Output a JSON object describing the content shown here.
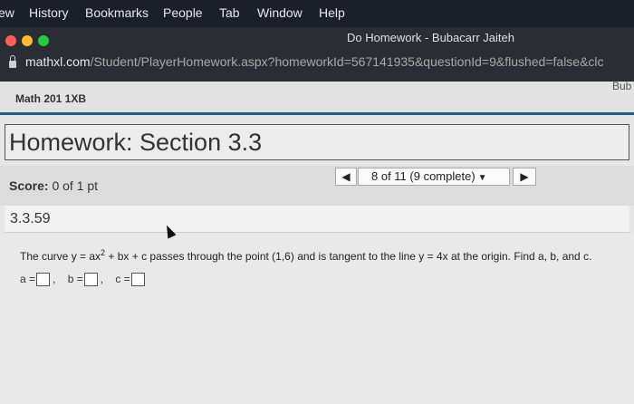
{
  "menubar": {
    "items": [
      "ew",
      "History",
      "Bookmarks",
      "People",
      "Tab",
      "Window",
      "Help"
    ]
  },
  "browser": {
    "window_title": "Do Homework - Bubacarr Jaiteh",
    "url_host": "mathxl.com",
    "url_path": "/Student/PlayerHomework.aspx?homeworkId=567141935&questionId=9&flushed=false&clc"
  },
  "page": {
    "course": "Math 201 1XB",
    "user": "Bub",
    "homework_title": "Homework: Section 3.3",
    "score_label": "Score:",
    "score_value": "0 of 1 pt",
    "nav_prev": "◀",
    "nav_status": "8 of 11 (9 complete)",
    "nav_caret": "▼",
    "nav_next": "▶",
    "question_number": "3.3.59",
    "question_pre": "The curve y = ax",
    "question_exp": "2",
    "question_post": " + bx + c passes through the point (1,6) and is tangent to the line y = 4x at the origin. Find a, b, and c.",
    "answers": [
      {
        "label": "a =",
        "suffix": ","
      },
      {
        "label": "b =",
        "suffix": ","
      },
      {
        "label": "c =",
        "suffix": ""
      }
    ]
  }
}
